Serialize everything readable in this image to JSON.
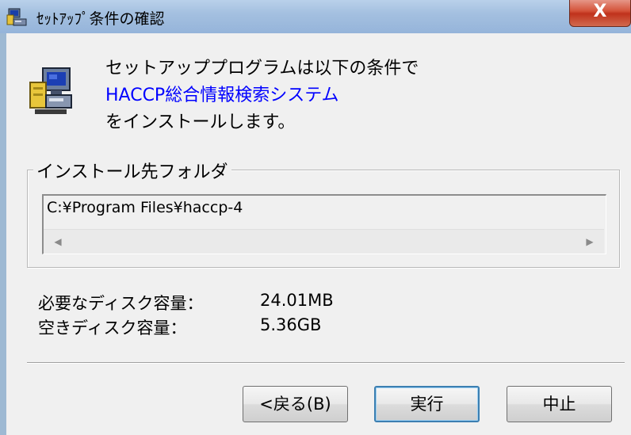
{
  "window": {
    "title": "ｾｯﾄｱｯﾌﾟ条件の確認",
    "close_label": "X",
    "icons": {
      "title": "setup-computer-icon",
      "app": "setup-computer-icon",
      "close": "close-icon"
    }
  },
  "intro": {
    "line1": "セットアッププログラムは以下の条件で",
    "product": "HACCP総合情報検索システム",
    "line3": "をインストールします。"
  },
  "install_folder": {
    "legend": "インストール先フォルダ",
    "path": "C:¥Program Files¥haccp-4",
    "scroll_left_icon": "scroll-left-arrow-icon",
    "scroll_right_icon": "scroll-right-arrow-icon"
  },
  "disk": {
    "required_label": "必要なディスク容量：",
    "required_value": "24.01MB",
    "free_label": "空きディスク容量：",
    "free_value": "5.36GB"
  },
  "buttons": {
    "back": "<戻る(B)",
    "run": "実行",
    "cancel": "中止"
  },
  "colors": {
    "product_text": "#0000ff",
    "close_button": "#c8432b",
    "titlebar": "#a4c0e0"
  }
}
